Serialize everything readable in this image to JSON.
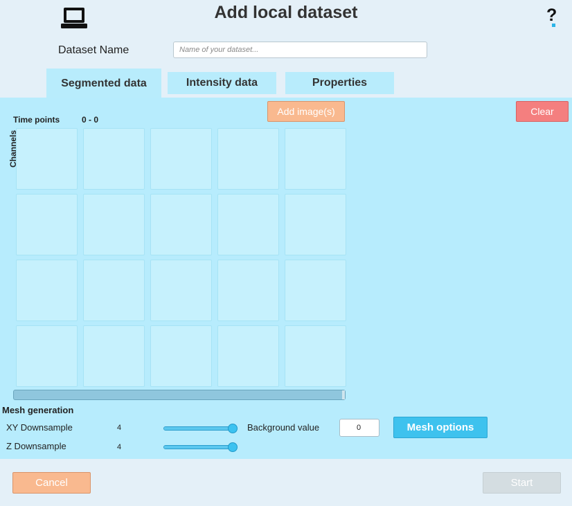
{
  "header": {
    "title": "Add local dataset",
    "icon": "laptop-icon",
    "help_label": "?",
    "help_accent": "#2ab4e8"
  },
  "dataset_name": {
    "label": "Dataset Name",
    "placeholder": "Name of your dataset...",
    "value": ""
  },
  "tabs": [
    {
      "label": "Segmented data",
      "active": true
    },
    {
      "label": "Intensity data",
      "active": false
    },
    {
      "label": "Properties",
      "active": false
    }
  ],
  "segmented": {
    "time_points_label": "Time points",
    "time_points_range": "0 - 0",
    "channels_label": "Channels",
    "add_images_label": "Add image(s)",
    "clear_label": "Clear",
    "grid_rows": 4,
    "grid_cols": 5
  },
  "mesh": {
    "title": "Mesh generation",
    "xy_label": "XY Downsample",
    "xy_value": "4",
    "xy_level": 1.0,
    "z_label": "Z Downsample",
    "z_value": "4",
    "z_level": 1.0,
    "background_label": "Background value",
    "background_value": "0",
    "options_label": "Mesh options"
  },
  "footer": {
    "cancel_label": "Cancel",
    "start_label": "Start",
    "start_enabled": false
  },
  "colors": {
    "panel": "#b7ecfd",
    "tab": "#b8ecfc",
    "orange_button": "#f9b98f",
    "red_button": "#f47f7f",
    "blue_button": "#3ec2ee",
    "disabled_button": "#d4dde1"
  }
}
